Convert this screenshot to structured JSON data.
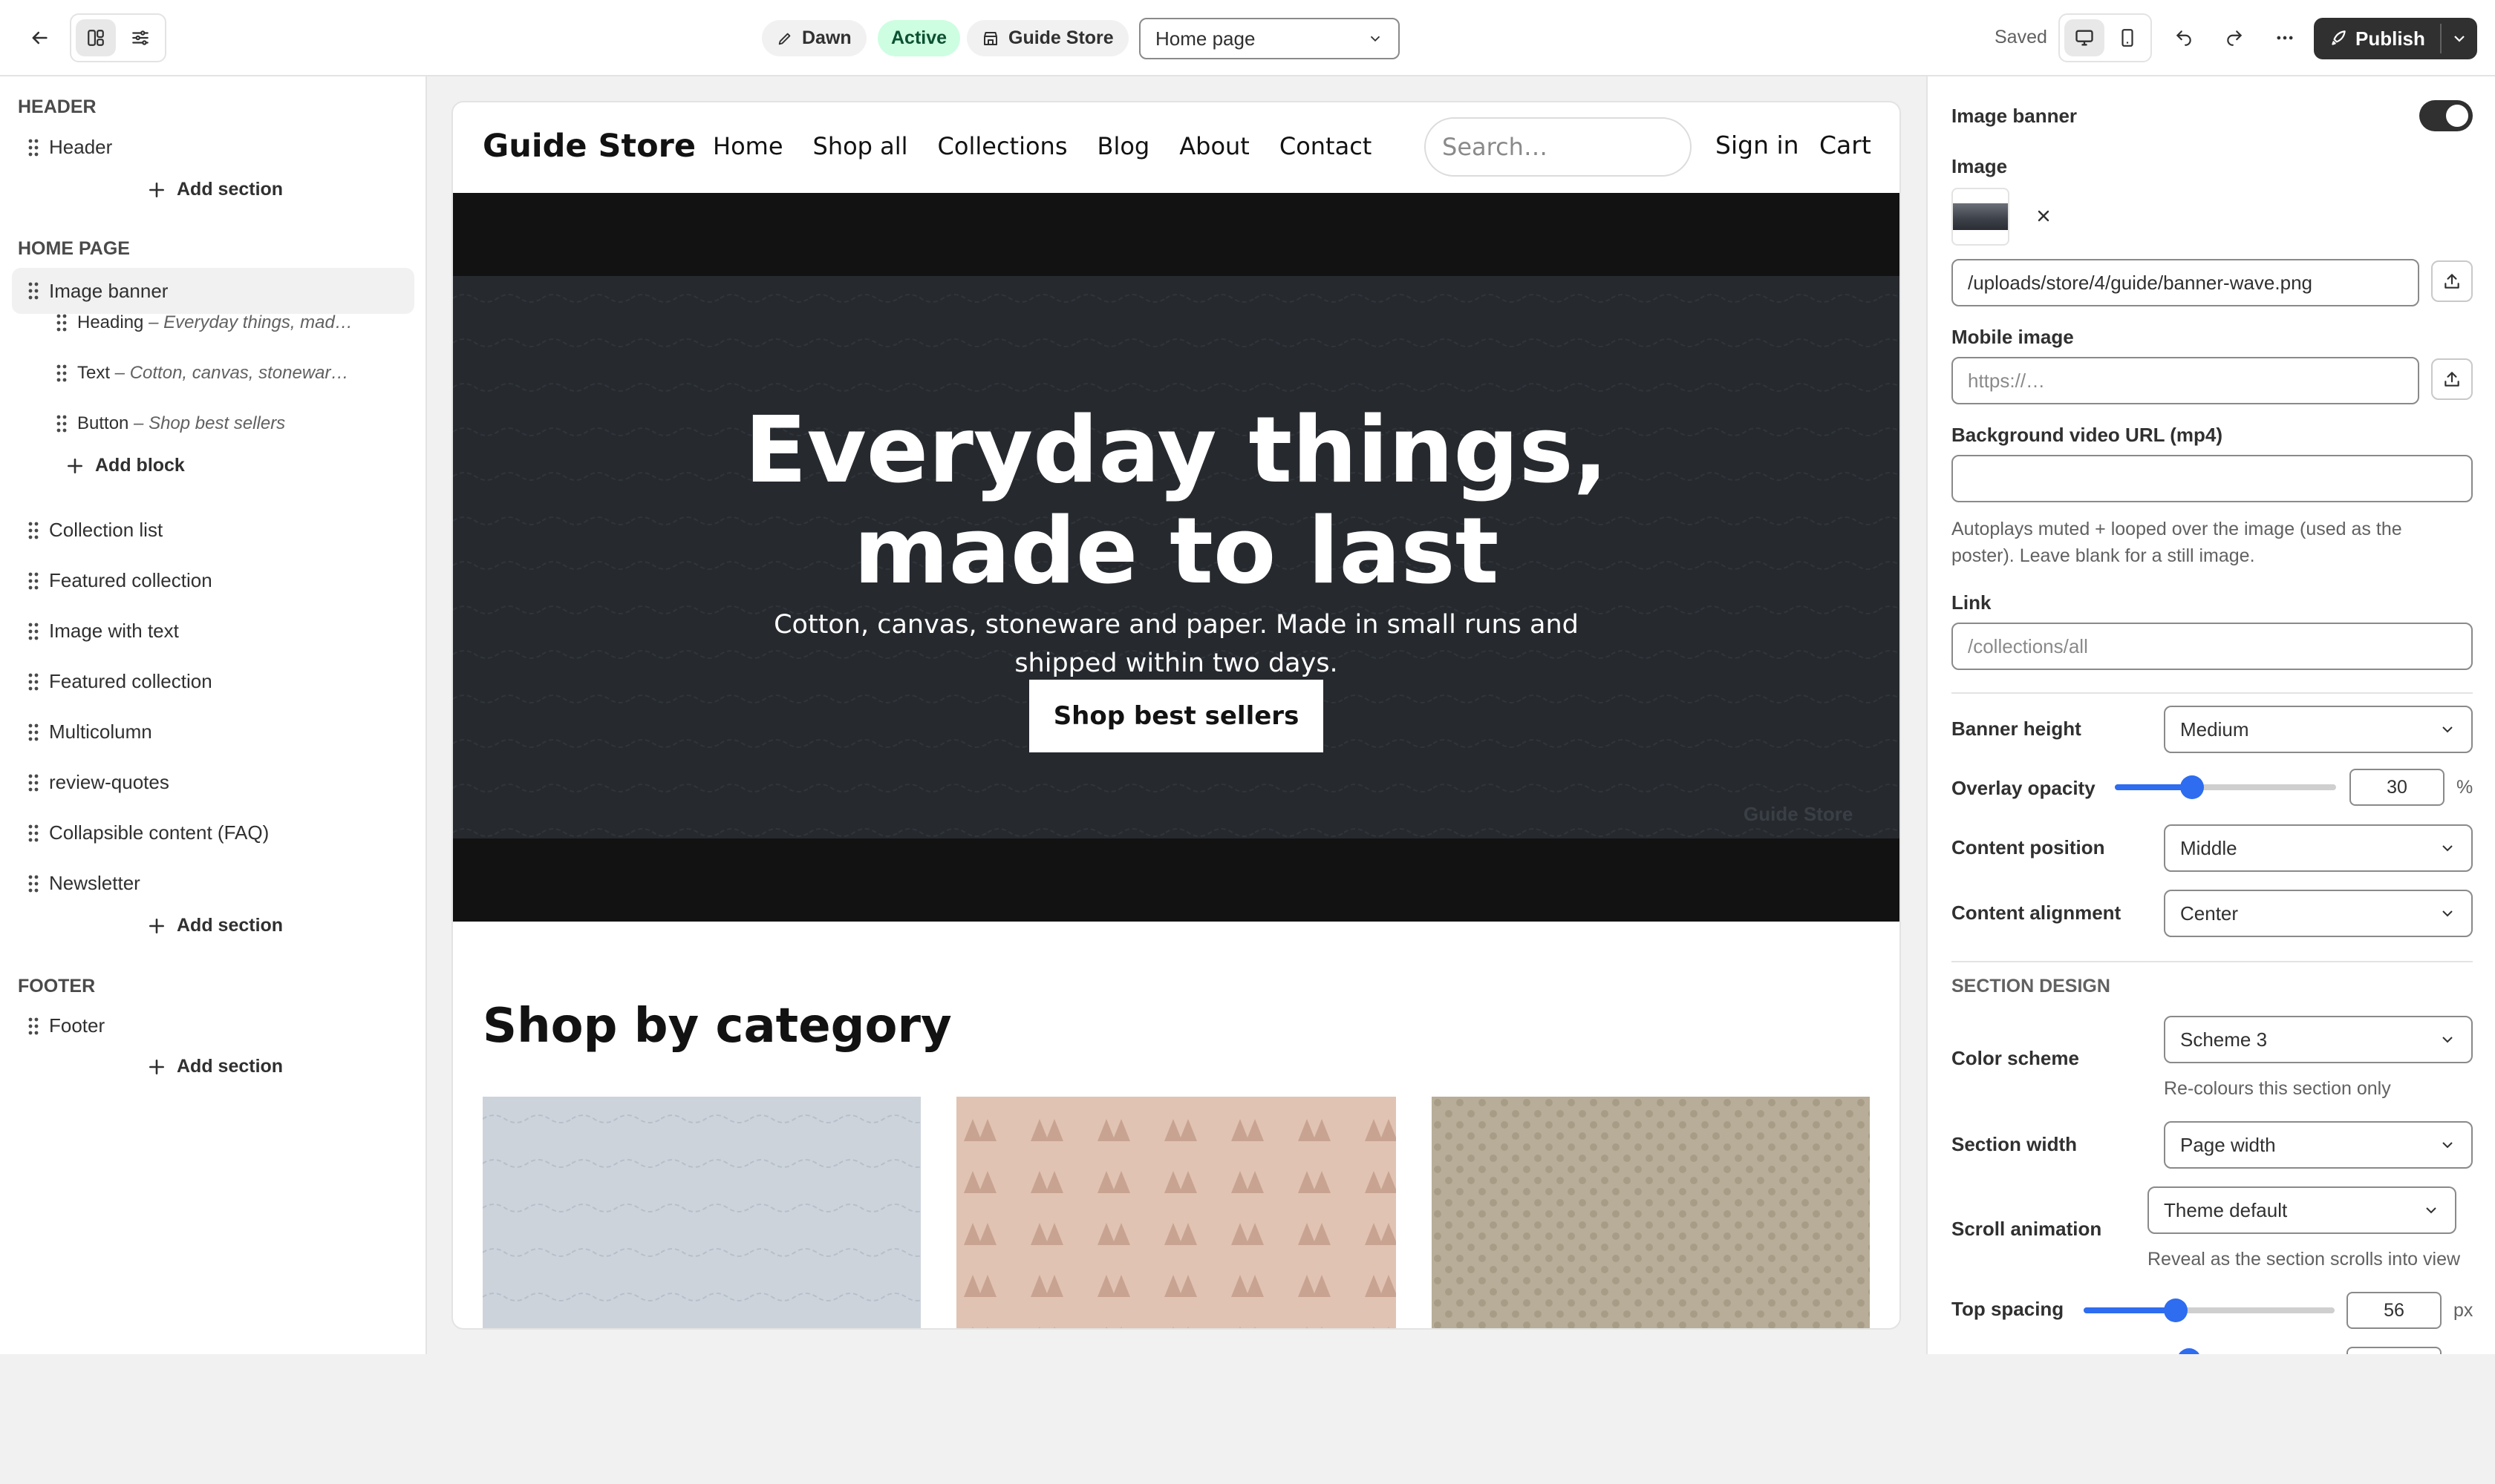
{
  "topbar": {
    "theme_name": "Dawn",
    "theme_status": "Active",
    "store_name": "Guide Store",
    "page_select": "Home page",
    "saved_label": "Saved",
    "publish_label": "Publish"
  },
  "sidebar": {
    "header_group": "HEADER",
    "header_item": "Header",
    "add_section": "Add section",
    "home_group": "HOME PAGE",
    "image_banner": "Image banner",
    "blocks": [
      {
        "type": "Heading",
        "sep": " – ",
        "value": "Everyday things, mad…"
      },
      {
        "type": "Text",
        "sep": " – ",
        "value": "Cotton, canvas, stonewar…"
      },
      {
        "type": "Button",
        "sep": " – ",
        "value": "Shop best sellers"
      }
    ],
    "add_block": "Add block",
    "sections": [
      "Collection list",
      "Featured collection",
      "Image with text",
      "Featured collection",
      "Multicolumn",
      "review-quotes",
      "Collapsible content (FAQ)",
      "Newsletter"
    ],
    "footer_group": "FOOTER",
    "footer_item": "Footer"
  },
  "preview": {
    "store_title": "Guide Store",
    "nav": [
      "Home",
      "Shop all",
      "Collections",
      "Blog",
      "About",
      "Contact"
    ],
    "search_placeholder": "Search…",
    "sign_in": "Sign in",
    "cart": "Cart",
    "hero_heading_line1": "Everyday things,",
    "hero_heading_line2": "made to last",
    "hero_text_line1": "Cotton, canvas, stoneware and paper. Made in small runs and",
    "hero_text_line2": "shipped within two days.",
    "hero_button": "Shop best sellers",
    "watermark": "Guide Store",
    "category_heading": "Shop by category"
  },
  "settings": {
    "section_title": "Image banner",
    "section_enabled": true,
    "image_label": "Image",
    "image_path": "/uploads/store/4/guide/banner-wave.png",
    "mobile_image_label": "Mobile image",
    "mobile_image_placeholder": "https://…",
    "video_label": "Background video URL (mp4)",
    "video_value": "",
    "video_help_line1": "Autoplays muted + looped over the image (used as the",
    "video_help_line2": "poster). Leave blank for a still image.",
    "link_label": "Link",
    "link_placeholder": "/collections/all",
    "banner_height_label": "Banner height",
    "banner_height_value": "Medium",
    "overlay_label": "Overlay opacity",
    "overlay_value": "30",
    "overlay_fraction": 0.3,
    "overlay_unit": "%",
    "content_position_label": "Content position",
    "content_position_value": "Middle",
    "content_alignment_label": "Content alignment",
    "content_alignment_value": "Center",
    "design_heading": "SECTION DESIGN",
    "color_scheme_label": "Color scheme",
    "color_scheme_value": "Scheme 3",
    "color_scheme_help": "Re-colours this section only",
    "section_width_label": "Section width",
    "section_width_value": "Page width",
    "scroll_animation_label": "Scroll animation",
    "scroll_animation_value": "Theme default",
    "scroll_animation_help": "Reveal as the section scrolls into view",
    "top_spacing_label": "Top spacing",
    "top_spacing_value": "56",
    "top_spacing_unit": "px"
  },
  "colors": {
    "accent": "#2e6cf0",
    "publish_bg": "#303030",
    "active_badge_bg": "#cdfee1",
    "hero_bg": "#2f3339"
  }
}
